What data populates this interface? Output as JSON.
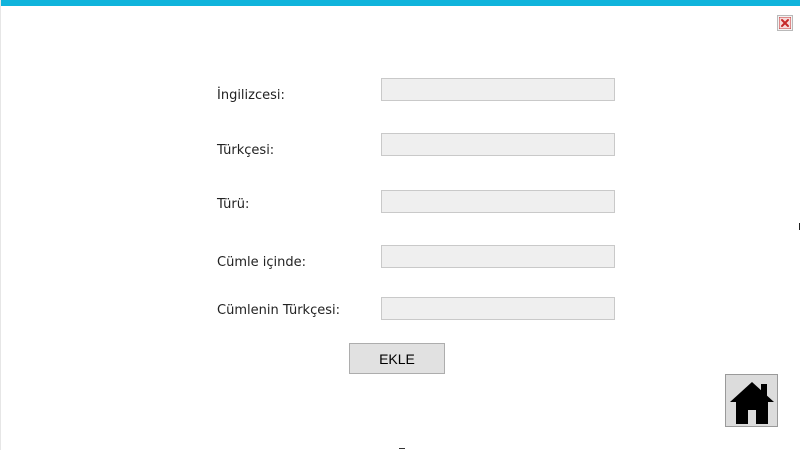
{
  "window": {
    "accent_color": "#10b4dc",
    "close_icon": "close-icon"
  },
  "form": {
    "fields": [
      {
        "label": "İngilizcesi:",
        "value": ""
      },
      {
        "label": "Türkçesi:",
        "value": ""
      },
      {
        "label": "Türü:",
        "value": ""
      },
      {
        "label": "Cümle içinde:",
        "value": ""
      },
      {
        "label": "Cümlenin Türkçesi:",
        "value": ""
      }
    ],
    "submit_label": "EKLE"
  },
  "home": {
    "icon": "home-icon"
  }
}
